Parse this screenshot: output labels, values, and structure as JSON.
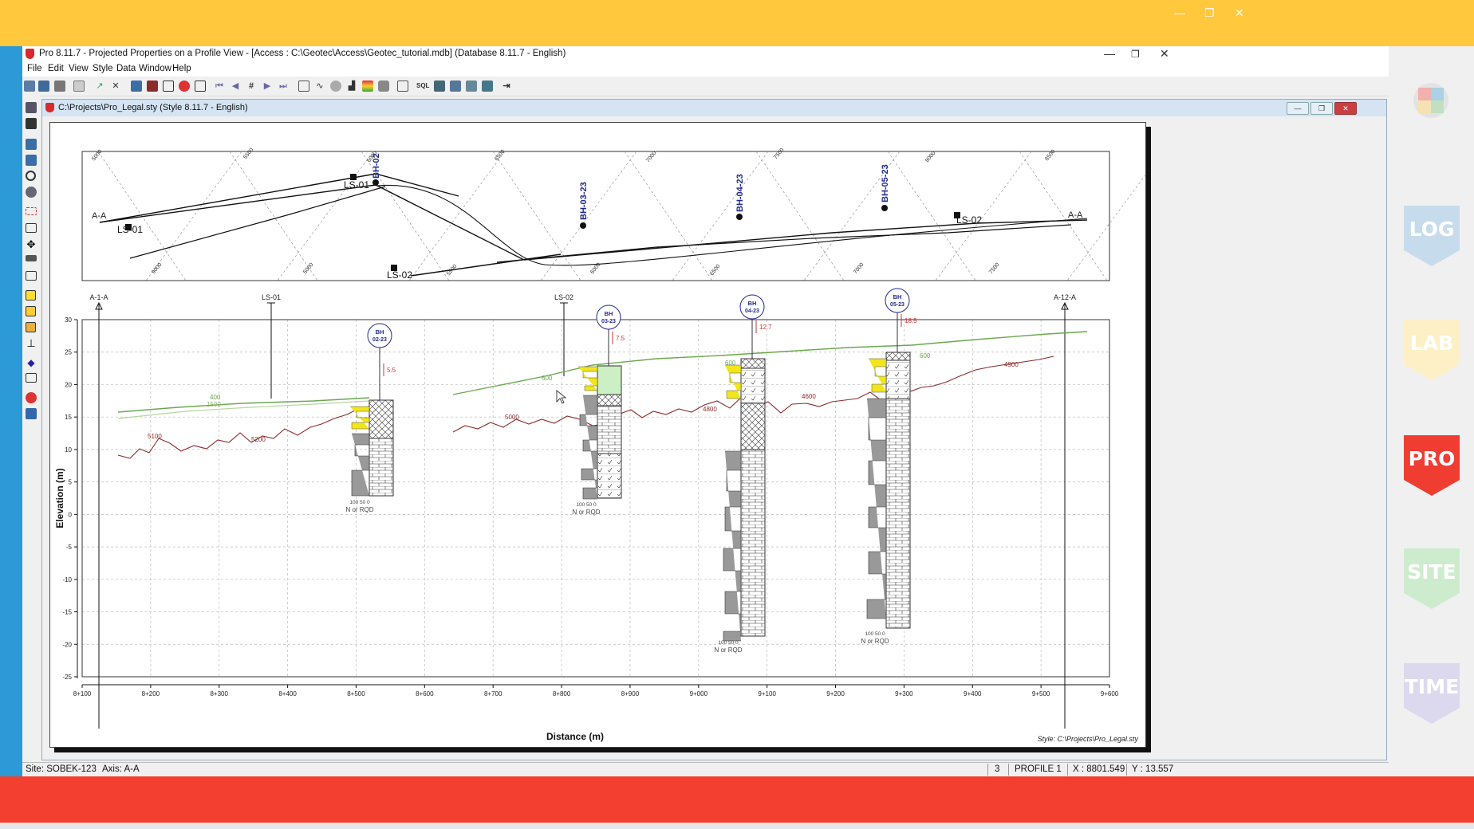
{
  "app": {
    "title": "Pro 8.11.7 - Projected Properties on a Profile View - [Access : C:\\Geotec\\Access\\Geotec_tutorial.mdb] (Database 8.11.7 - English)",
    "menu": [
      "File",
      "Edit",
      "View",
      "Style",
      "Data",
      "Window",
      "Help"
    ]
  },
  "document": {
    "title": "C:\\Projects\\Pro_Legal.sty (Style 8.11.7 - English)",
    "footer": "Style: C:\\Projects\\Pro_Legal.sty"
  },
  "plan": {
    "section_label": "A-A",
    "line_labels": [
      "LS-01",
      "LS-02"
    ],
    "boreholes": [
      "BH-02",
      "BH-03-23",
      "BH-04-23",
      "BH-05-23"
    ],
    "grid_labels": [
      "5000",
      "5500",
      "6000",
      "6500",
      "7000",
      "7500",
      "8000",
      "8500",
      "9000"
    ]
  },
  "profile": {
    "top_markers": [
      "A-1-A",
      "LS-01",
      "LS-02",
      "A-12-A"
    ],
    "x_axis_title": "Distance (m)",
    "y_axis_title": "Elevation (m)",
    "x_ticks": [
      "8+100",
      "8+200",
      "8+300",
      "8+400",
      "8+500",
      "8+600",
      "8+700",
      "8+800",
      "8+900",
      "9+000",
      "9+100",
      "9+200",
      "9+300",
      "9+400",
      "9+500",
      "9+600"
    ],
    "y_ticks": [
      "30",
      "25",
      "20",
      "15",
      "10",
      "5",
      "0",
      "-5",
      "-10",
      "-15",
      "-20",
      "-25"
    ],
    "boreholes": [
      {
        "bh": "BH",
        "id": "02-23",
        "water": "5.5",
        "scale": "100 50 0",
        "label": "N or RQD"
      },
      {
        "bh": "BH",
        "id": "03-23",
        "water": "7.5",
        "scale": "100 50 0",
        "label": "N or RQD"
      },
      {
        "bh": "BH",
        "id": "04-23",
        "water": "12.7",
        "scale": "100 50 0",
        "label": "N or RQD"
      },
      {
        "bh": "BH",
        "id": "05-23",
        "water": "18.5",
        "scale": "100 50 0",
        "label": "N or RQD"
      }
    ],
    "green_labels": [
      "400",
      "1500",
      "600",
      "600",
      "600"
    ],
    "red_labels": [
      "5100",
      "5200",
      "5000",
      "600",
      "4800",
      "4600",
      "4900"
    ]
  },
  "status": {
    "site": "Site: SOBEK-123",
    "axis": "Axis: A-A",
    "page": "3",
    "profile": "PROFILE  1",
    "x": "X : 8801.549",
    "y": "Y : 13.557"
  },
  "modules": [
    "LOG",
    "LAB",
    "PRO",
    "SITE",
    "TIME"
  ],
  "colors": {
    "banner_top": "#ffc83d",
    "banner_bottom": "#f33f2f",
    "left_strip": "#2b9ad6",
    "ground_green": "#6aa84f",
    "rock_red": "#8b2a2a",
    "borehole_blue": "#1f2a8c",
    "n_value_yellow": "#f2e51a"
  }
}
